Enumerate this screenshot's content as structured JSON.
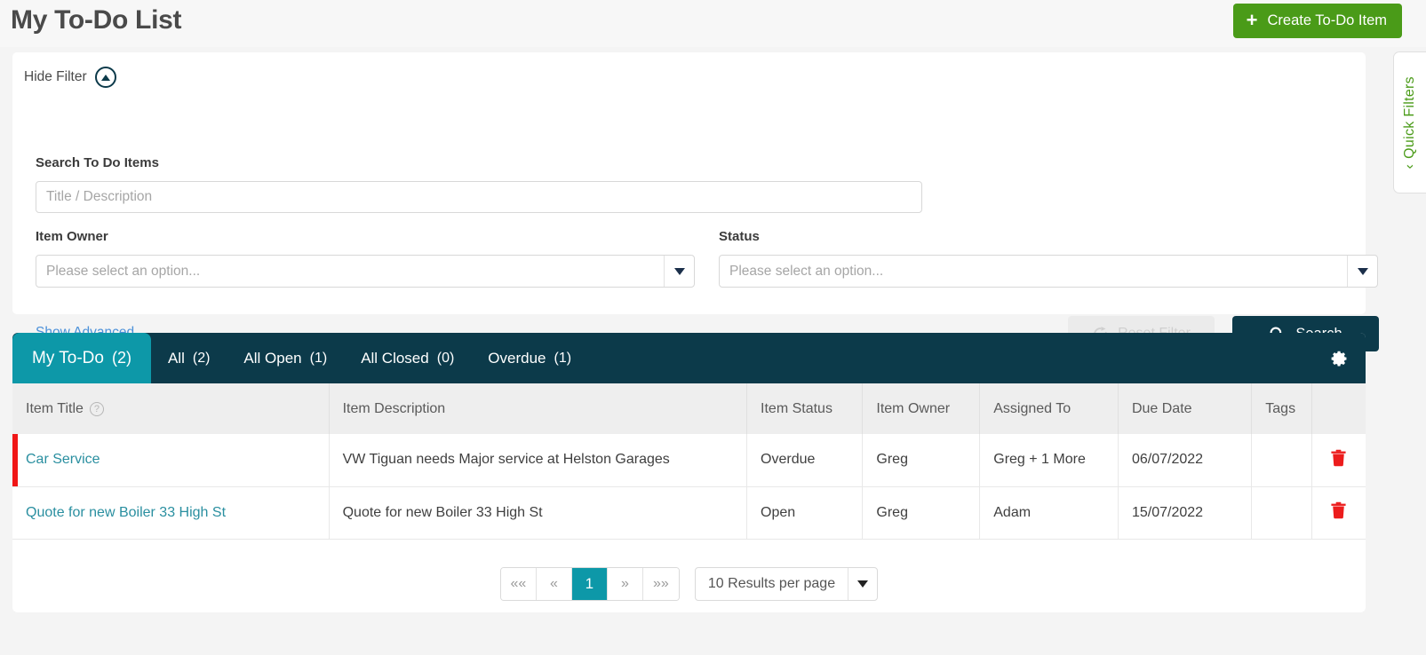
{
  "header": {
    "title": "My To-Do List",
    "create_button": "Create To-Do Item",
    "plus_glyph": "+"
  },
  "quick_filters": {
    "label": "Quick Filters",
    "chevron": "‹"
  },
  "filter": {
    "hide_filter_label": "Hide Filter",
    "search_label": "Search To Do Items",
    "search_value": "",
    "search_placeholder": "Title / Description",
    "owner_label": "Item Owner",
    "owner_value": "Please select an option...",
    "status_label": "Status",
    "status_value": "Please select an option...",
    "show_advanced": "Show Advanced",
    "reset_button": "Reset Filter",
    "search_button": "Search"
  },
  "tabs": [
    {
      "label": "My To-Do",
      "count": "(2)",
      "active": true
    },
    {
      "label": "All",
      "count": "(2)",
      "active": false
    },
    {
      "label": "All Open",
      "count": "(1)",
      "active": false
    },
    {
      "label": "All Closed",
      "count": "(0)",
      "active": false
    },
    {
      "label": "Overdue",
      "count": "(1)",
      "active": false
    }
  ],
  "table": {
    "columns": [
      "Item Title",
      "Item Description",
      "Item Status",
      "Item Owner",
      "Assigned To",
      "Due Date",
      "Tags"
    ],
    "title_help_glyph": "?",
    "rows": [
      {
        "title": "Car Service",
        "description": "VW Tiguan needs Major service at Helston Garages",
        "status": "Overdue",
        "owner": "Greg",
        "assigned_to": "Greg + 1 More",
        "due_date": "06/07/2022",
        "tags": "",
        "flagged": true
      },
      {
        "title": "Quote for new Boiler 33 High St",
        "description": "Quote for new Boiler 33 High St",
        "status": "Open",
        "owner": "Greg",
        "assigned_to": "Adam",
        "due_date": "15/07/2022",
        "tags": "",
        "flagged": false
      }
    ]
  },
  "pagination": {
    "first": "««",
    "prev": "«",
    "current_page": "1",
    "next": "»",
    "last": "»»",
    "results_per_page": "10 Results per page"
  },
  "colors": {
    "accent_green": "#4a9b18",
    "accent_teal": "#0d98a8",
    "dark_navy": "#0c3a4a",
    "link_blue": "#4a90d9",
    "flag_red": "#f01616"
  }
}
